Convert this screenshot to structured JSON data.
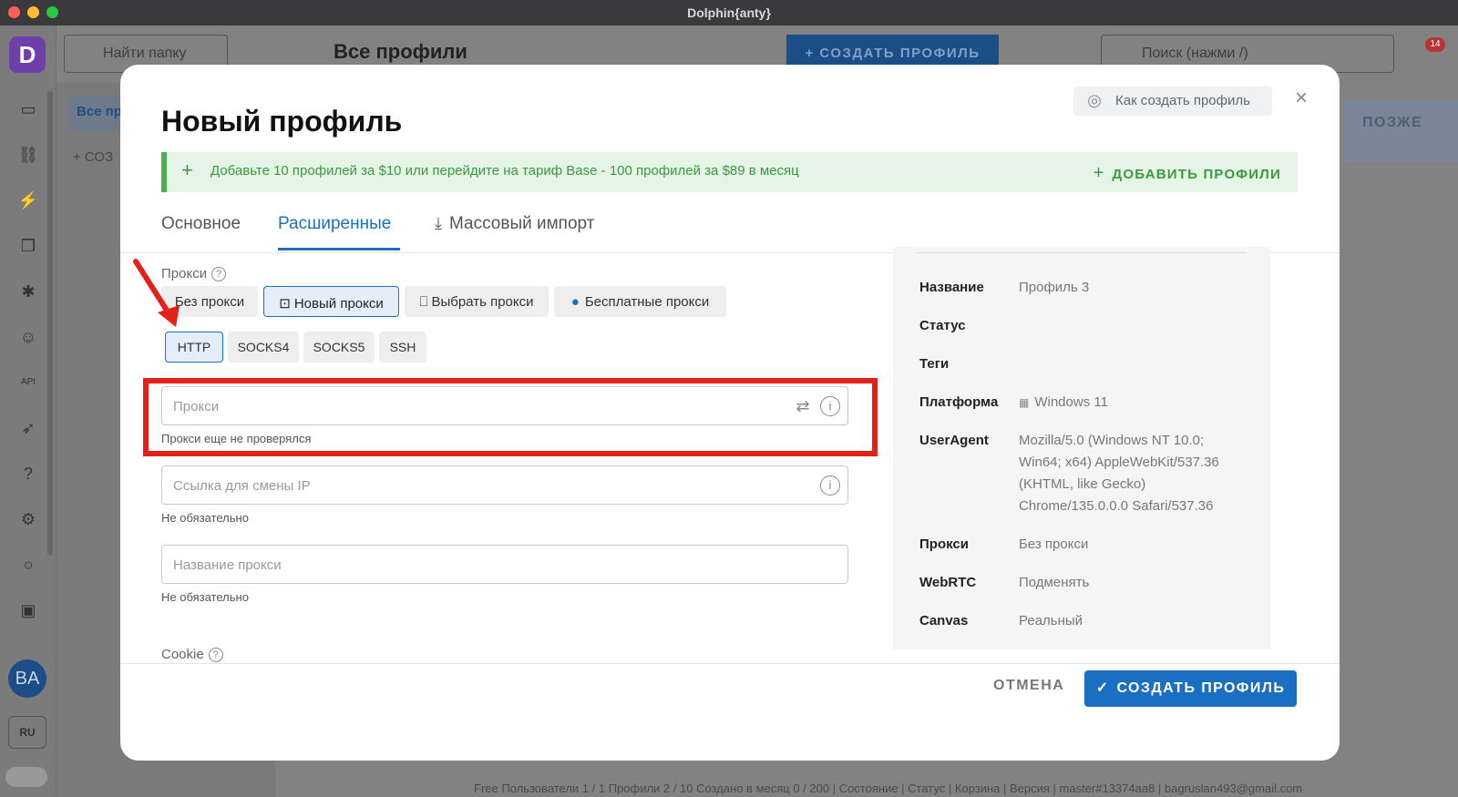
{
  "window": {
    "title": "Dolphin{anty}"
  },
  "background": {
    "search_folder_placeholder": "Найти папку",
    "page_title": "Все профили",
    "create_profile": "+ СОЗДАТЬ ПРОФИЛЬ",
    "search_placeholder": "Поиск (нажми /)",
    "notifications_count": "14",
    "later_button": "ПОЗЖЕ",
    "left_tab": "Все пр",
    "left_create": "+ СОЗ",
    "avatar_initials": "BA",
    "language": "RU",
    "status_bar": "Free  Пользователи 1 / 1  Профили 2 / 10  Создано в месяц 0 / 200  |  Состояние  |  Статус  |  Корзина  |  Версия  |  master#13374aa8  |  bagruslan493@gmail.com"
  },
  "modal": {
    "title": "Новый профиль",
    "help_button": "Как создать профиль",
    "banner": {
      "text": "Добавьте 10 профилей за $10 или перейдите на тариф Base - 100 профилей за $89 в месяц",
      "action": "ДОБАВИТЬ ПРОФИЛИ"
    },
    "tabs": [
      {
        "label": "Основное",
        "active": false
      },
      {
        "label": "Расширенные",
        "active": true
      },
      {
        "label": "Массовый импорт",
        "active": false
      }
    ],
    "proxy": {
      "label": "Прокси",
      "modes": [
        "Без прокси",
        "Новый прокси",
        "Выбрать прокси",
        "Бесплатные прокси"
      ],
      "active_mode": "Новый прокси",
      "types": [
        "HTTP",
        "SOCKS4",
        "SOCKS5",
        "SSH"
      ],
      "active_type": "HTTP",
      "proxy_input_placeholder": "Прокси",
      "proxy_hint": "Прокси еще не проверялся",
      "ip_change_placeholder": "Ссылка для смены IP",
      "ip_change_hint": "Не обязательно",
      "proxy_name_placeholder": "Название прокси",
      "proxy_name_hint": "Не обязательно"
    },
    "cookie_label": "Cookie",
    "summary": {
      "name_label": "Название",
      "name_value": "Профиль 3",
      "status_label": "Статус",
      "tags_label": "Теги",
      "platform_label": "Платформа",
      "platform_value": "Windows 11",
      "ua_label": "UserAgent",
      "ua_line1": "Mozilla/5.0 (Windows NT 10.0;",
      "ua_line2": "Win64; x64) AppleWebKit/537.36",
      "ua_line3": "(KHTML, like Gecko)",
      "ua_line4": "Chrome/135.0.0.0 Safari/537.36",
      "proxy_label": "Прокси",
      "proxy_value": "Без прокси",
      "webrtc_label": "WebRTC",
      "webrtc_value": "Подменять",
      "canvas_label": "Canvas",
      "canvas_value": "Реальный"
    },
    "cancel": "ОТМЕНА",
    "create": "СОЗДАТЬ ПРОФИЛЬ"
  },
  "colors": {
    "accent": "#1b6fc2",
    "highlight": "#e5201b",
    "banner_green": "#3a9a3e"
  }
}
